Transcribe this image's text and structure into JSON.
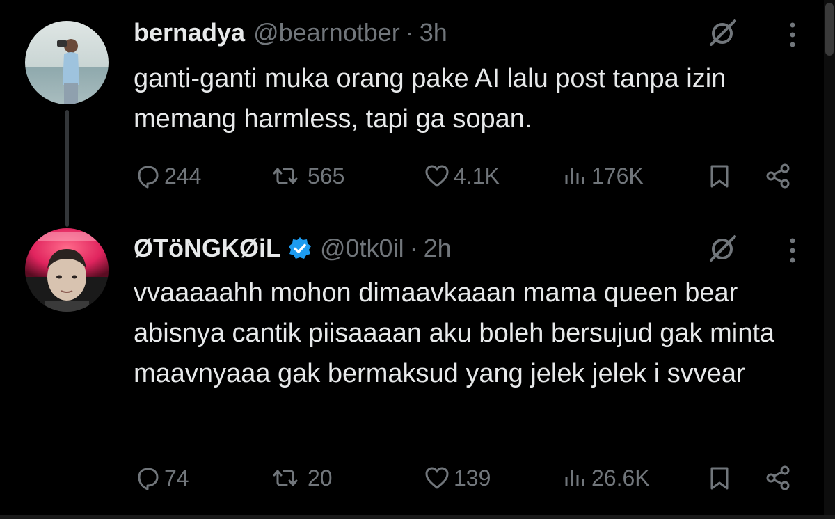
{
  "tweets": [
    {
      "name": "bernadya",
      "handle": "@bearnotber",
      "separator": "·",
      "time": "3h",
      "verified": false,
      "text": "ganti-ganti muka orang pake AI lalu post tanpa izin memang harmless, tapi ga sopan.",
      "replies": "244",
      "reposts": "565",
      "likes": "4.1K",
      "views": "176K"
    },
    {
      "name": "ØTöNGKØiL",
      "handle": "@0tk0il",
      "separator": "·",
      "time": "2h",
      "verified": true,
      "text": "vvaaaaahh mohon dimaavkaaan mama queen bear abisnya cantik piisaaaan aku boleh bersujud gak minta maavnyaaa gak bermaksud yang jelek jelek i svvear",
      "replies": "74",
      "reposts": "20",
      "likes": "139",
      "views": "26.6K"
    }
  ],
  "colors": {
    "background": "#000000",
    "text": "#e7e9ea",
    "muted": "#71767b",
    "verified": "#1d9bf0",
    "thread_line": "#333639"
  },
  "icons": [
    "reply-icon",
    "repost-icon",
    "like-icon",
    "views-icon",
    "bookmark-icon",
    "share-icon",
    "grok-icon",
    "more-icon",
    "verified-badge-icon"
  ]
}
